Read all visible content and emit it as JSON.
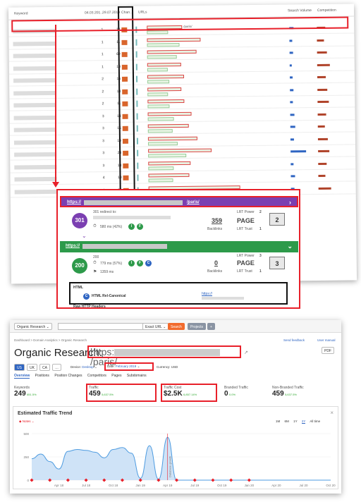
{
  "table": {
    "headers": [
      "Keyword",
      "04.03.201...",
      "29.07.2019",
      "Chan...",
      "URLs",
      "Search Volume",
      "Competition"
    ],
    "rows": [
      {
        "v1": "1",
        "v2": "13",
        "url": "/paris/"
      },
      {
        "v1": "1",
        "v2": "11",
        "url": ""
      },
      {
        "v1": "1",
        "v2": "69",
        "url": ""
      },
      {
        "v1": "1",
        "v2": "10",
        "url": ""
      },
      {
        "v1": "2",
        "v2": "16",
        "url": ""
      },
      {
        "v1": "2",
        "v2": "10",
        "url": ""
      },
      {
        "v1": "2",
        "v2": "11",
        "url": ""
      },
      {
        "v1": "3",
        "v2": "14",
        "url": ""
      },
      {
        "v1": "3",
        "v2": "15",
        "url": ""
      },
      {
        "v1": "3",
        "v2": "10",
        "url": ""
      },
      {
        "v1": "3",
        "v2": "23",
        "url": ""
      },
      {
        "v1": "3",
        "v2": "13",
        "url": ""
      },
      {
        "v1": "4",
        "v2": "10",
        "url": ""
      },
      {
        "v1": "4",
        "v2": "22",
        "url": ""
      }
    ]
  },
  "popup": {
    "redirect": {
      "url_prefix": "https://",
      "url_suffix": "/paris/",
      "code": "301",
      "label": "301 redirect to:",
      "timing": "580 ms (42%)",
      "icon_letters": [
        "I",
        "F"
      ],
      "backlinks_value": "359",
      "backlinks_label": "Backlinks",
      "page_label": "PAGE",
      "lrt_power_label": "LRT Power",
      "lrt_power_value": "2",
      "lrt_trust_label": "LRT Trust",
      "lrt_trust_value": "1",
      "box_value": "2"
    },
    "final": {
      "url_prefix": "https://",
      "code": "200",
      "label": "200",
      "timing": "779 ms (57%)",
      "timing2": "1359 ms",
      "icon_letters": [
        "I",
        "F",
        "C"
      ],
      "backlinks_value": "0",
      "backlinks_label": "Backlinks",
      "page_label": "PAGE",
      "lrt_power_label": "LRT Power",
      "lrt_power_value": "3",
      "lrt_trust_label": "LRT Trust",
      "lrt_trust_value": "1",
      "box_value": "3"
    },
    "html_section": {
      "heading": "HTML",
      "rel_canonical": "HTML Rel-Canonical",
      "rel_value": "https://",
      "raw_headers": "Raw HTTP Headers"
    }
  },
  "research": {
    "search_dropdown": "Organic Research",
    "url_mode": "Exact URL",
    "search_btn": "Search",
    "projects_btn": "Projects",
    "send_feedback": "Send feedback",
    "user_manual": "User manual",
    "pdf": "PDF",
    "breadcrumb": "Dashboard > Domain Analytics > Organic Research",
    "page_title": "Organic Research:",
    "url_prefix": "https:",
    "url_suffix": "/paris/",
    "flags": [
      "US",
      "UK",
      "CA"
    ],
    "device_label": "Device:",
    "device_value": "Desktop",
    "date_label": "Date:",
    "date_value": "February 2019",
    "currency_label": "Currency:",
    "currency_value": "USD",
    "tabs": [
      "Overview",
      "Positions",
      "Position Changes",
      "Competitors",
      "Pages",
      "Subdomains"
    ],
    "kpis": [
      {
        "label": "Keywords",
        "value": "249",
        "delta": "651.5%"
      },
      {
        "label": "Traffic",
        "value": "459",
        "delta": "5,637.5%"
      },
      {
        "label": "Traffic Cost",
        "value": "$2.5K",
        "delta": "6,857.14%"
      },
      {
        "label": "Branded Traffic",
        "value": "0",
        "delta": "0.0%"
      },
      {
        "label": "Non-Branded Traffic",
        "value": "459",
        "delta": "5,637.5%"
      }
    ],
    "trend_title": "Estimated Traffic Trend",
    "notes_label": "Notes",
    "ranges": [
      "1M",
      "6M",
      "1Y",
      "2Y",
      "All time"
    ],
    "active_range": "2Y",
    "y_ticks": [
      "500",
      "250",
      "0"
    ],
    "x_ticks": [
      "Apr 18",
      "Jul 18",
      "Oct 18",
      "Jan 19",
      "Apr 19",
      "Jul 19",
      "Oct 19",
      "Jan 20",
      "Apr 20",
      "Jul 20",
      "Oct 20"
    ],
    "annotation": "Database growth"
  },
  "chart_data": {
    "type": "area",
    "x": [
      "Jan 18",
      "Feb 18",
      "Mar 18",
      "Apr 18",
      "May 18",
      "Jun 18",
      "Jul 18",
      "Aug 18",
      "Sep 18",
      "Oct 18",
      "Nov 18",
      "Dec 18",
      "Jan 19",
      "Feb 19",
      "Mar 19",
      "Apr 19",
      "May 19",
      "Jun 19",
      "Jul 19",
      "Aug 19",
      "Sep 19",
      "Oct 19",
      "Nov 19",
      "Dec 19",
      "Jan 20",
      "Feb 20",
      "Mar 20",
      "Apr 20",
      "May 20",
      "Jun 20",
      "Jul 20",
      "Aug 20",
      "Sep 20",
      "Oct 20"
    ],
    "series": [
      {
        "values": [
          230,
          280,
          200,
          120,
          310,
          330,
          320,
          300,
          240,
          330,
          350,
          290,
          20,
          370,
          10,
          460,
          0,
          0,
          0,
          0,
          0,
          0,
          0,
          0,
          0,
          0,
          0,
          0,
          0,
          0,
          0,
          0,
          0,
          0
        ]
      }
    ],
    "ylim": [
      0,
      500
    ],
    "xlabel": "",
    "ylabel": ""
  }
}
